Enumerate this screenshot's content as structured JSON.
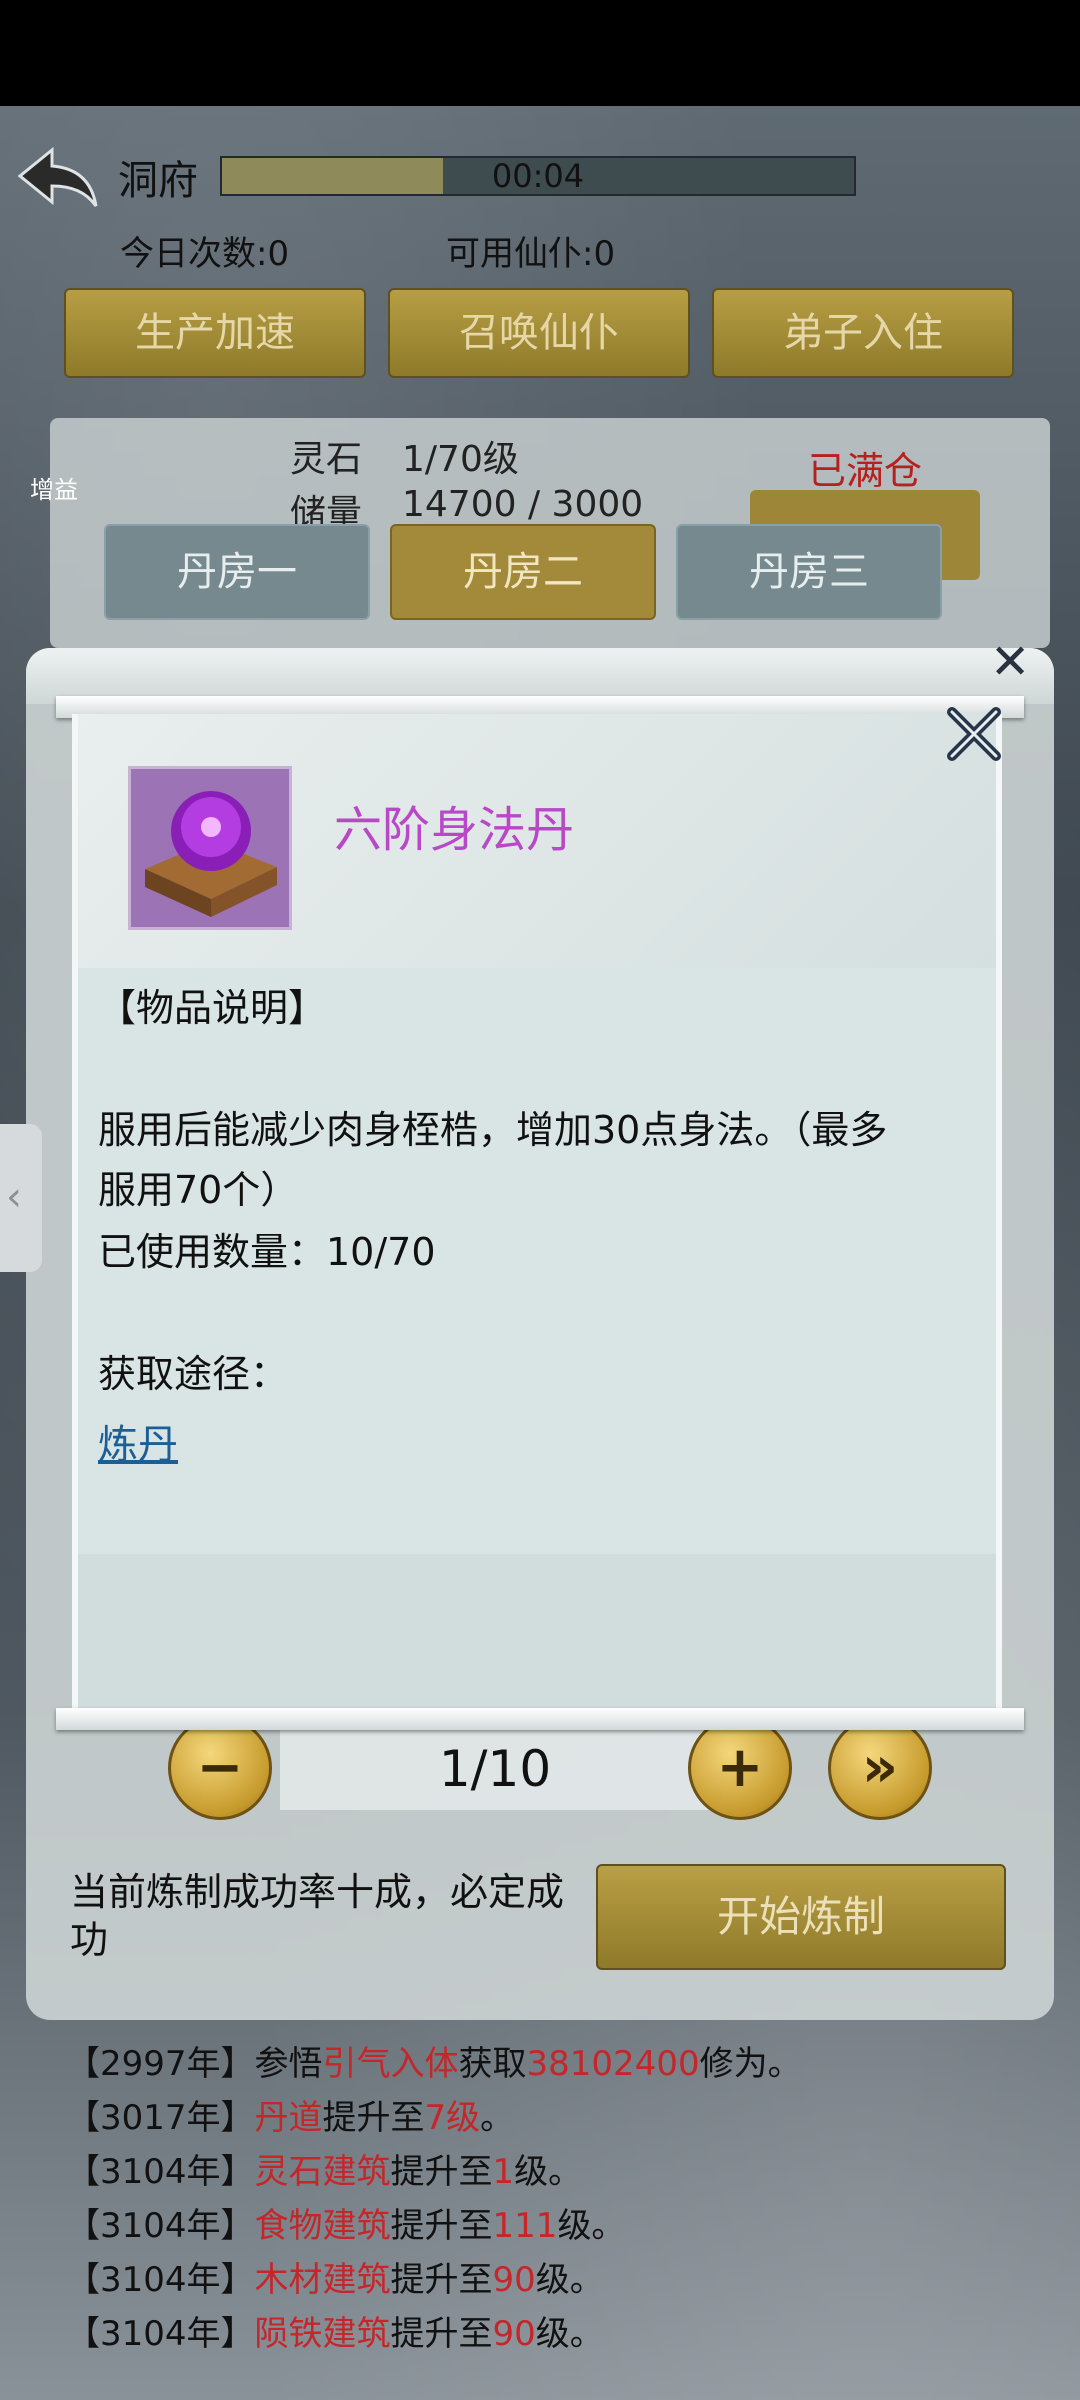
{
  "header": {
    "title": "洞府",
    "timer": "00:04",
    "progress_fraction": 0.35,
    "today_count": "今日次数:0",
    "available_servants": "可用仙仆:0"
  },
  "actions": {
    "speed_up": "生产加速",
    "summon": "召唤仙仆",
    "disciple": "弟子入住"
  },
  "building": {
    "name": "灵石",
    "level": "1/70级",
    "storage_label": "储量",
    "storage_value": "14700 / 3000",
    "full_label": "已满仓",
    "boost_label": "增益"
  },
  "rooms": {
    "room1": "丹房一",
    "room2": "丹房二",
    "room3": "丹房三"
  },
  "alchemy": {
    "quantity": "1/10",
    "rate_text": "当前炼制成功率十成，必定成功",
    "start_button": "开始炼制"
  },
  "modal": {
    "item_name": "六阶身法丹",
    "section_title": "【物品说明】",
    "desc_line1": "服用后能减少肉身桎梏，增加30点身法。（最多",
    "desc_line2": "服用70个）",
    "used_count": "已使用数量：10/70",
    "source_label": "获取途径：",
    "source_link": "炼丹"
  },
  "log": [
    {
      "year": "【2997年】",
      "a": "参悟",
      "b": "引气入体",
      "c": "获取",
      "d": "38102400",
      "e": "修为。"
    },
    {
      "year": "【3017年】",
      "a": "",
      "b": "丹道",
      "c": "提升至",
      "d": "7级",
      "e": "。"
    },
    {
      "year": "【3104年】",
      "a": "",
      "b": "灵石建筑",
      "c": "提升至",
      "d": "1",
      "e": "级。"
    },
    {
      "year": "【3104年】",
      "a": "",
      "b": "食物建筑",
      "c": "提升至",
      "d": "111",
      "e": "级。"
    },
    {
      "year": "【3104年】",
      "a": "",
      "b": "木材建筑",
      "c": "提升至",
      "d": "90",
      "e": "级。"
    },
    {
      "year": "【3104年】",
      "a": "",
      "b": "陨铁建筑",
      "c": "提升至",
      "d": "90",
      "e": "级。"
    }
  ],
  "colors": {
    "gold": "#b79e44",
    "red_highlight": "#c4262a",
    "item_purple": "#b848c7",
    "link_blue": "#1b5f96"
  }
}
